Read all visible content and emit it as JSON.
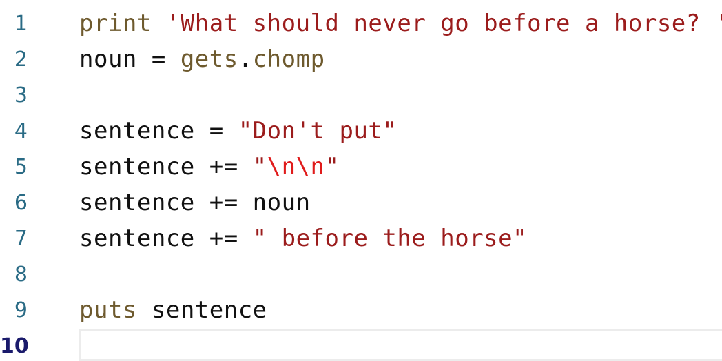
{
  "editor": {
    "lines": [
      {
        "number": "1",
        "tokens": {
          "kw": "print",
          "space": " ",
          "str": "'What should never go before a horse? '"
        }
      },
      {
        "number": "2",
        "tokens": {
          "var": "noun",
          "op": " = ",
          "call1": "gets",
          "dot": ".",
          "call2": "chomp"
        }
      },
      {
        "number": "3"
      },
      {
        "number": "4",
        "tokens": {
          "var": "sentence",
          "op": " = ",
          "str": "\"Don't put\""
        }
      },
      {
        "number": "5",
        "tokens": {
          "var": "sentence",
          "op": " += ",
          "q1": "\"",
          "esc": "\\n\\n",
          "q2": "\""
        }
      },
      {
        "number": "6",
        "tokens": {
          "var": "sentence",
          "op": " += ",
          "arg": "noun"
        }
      },
      {
        "number": "7",
        "tokens": {
          "var": "sentence",
          "op": " += ",
          "str": "\" before the horse\""
        }
      },
      {
        "number": "8"
      },
      {
        "number": "9",
        "tokens": {
          "kw": "puts",
          "space": " ",
          "arg": "sentence"
        }
      },
      {
        "number": "10"
      }
    ],
    "colors": {
      "line_number": "#2a6b85",
      "current_line_number": "#1a1a6b",
      "keyword": "#6e5a2e",
      "string": "#9b1c1c",
      "escape": "#e01b1b",
      "text": "#111111"
    }
  }
}
